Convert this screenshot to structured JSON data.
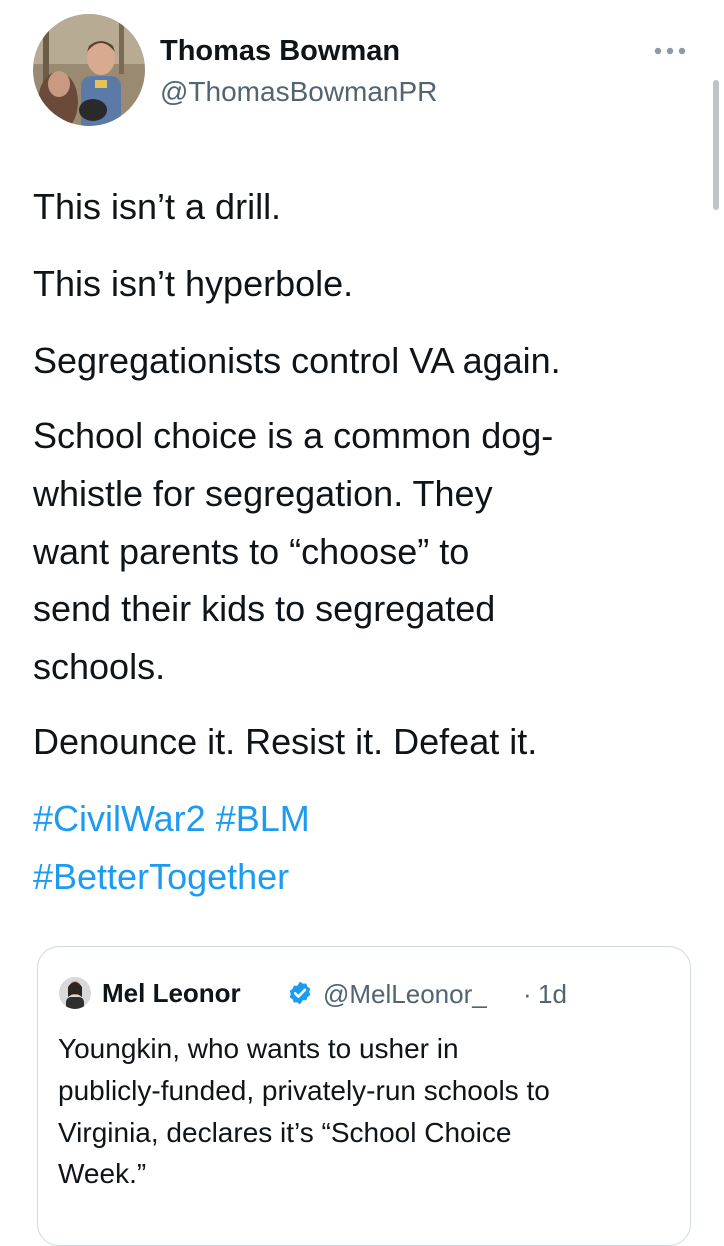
{
  "author": {
    "display_name": "Thomas Bowman",
    "handle": "@ThomasBowmanPR",
    "avatar_icon": "profile-photo"
  },
  "tweet": {
    "lines": [
      "This isn’t a drill.",
      "This isn’t hyperbole.",
      "Segregationists control VA again.",
      "School choice is a common dog-",
      "whistle for segregation. They",
      "want parents to “choose” to",
      "send their kids to segregated",
      "schools.",
      "Denounce it. Resist it. Defeat it."
    ],
    "hashtags": [
      "#CivilWar2",
      "#BLM",
      "#BetterTogether"
    ]
  },
  "quoted_tweet": {
    "display_name": "Mel Leonor",
    "verified_icon": "verified-badge-icon",
    "handle": "@MelLeonor_",
    "separator": "·",
    "time": "1d",
    "lines": [
      "Youngkin, who wants to usher in",
      "publicly-funded, privately-run schools to",
      "Virginia, declares it’s “School Choice",
      "Week.”"
    ]
  },
  "colors": {
    "link": "#1d9bf0",
    "secondary_text": "#536471",
    "primary_text": "#0f1419",
    "border": "#cfd9de"
  }
}
